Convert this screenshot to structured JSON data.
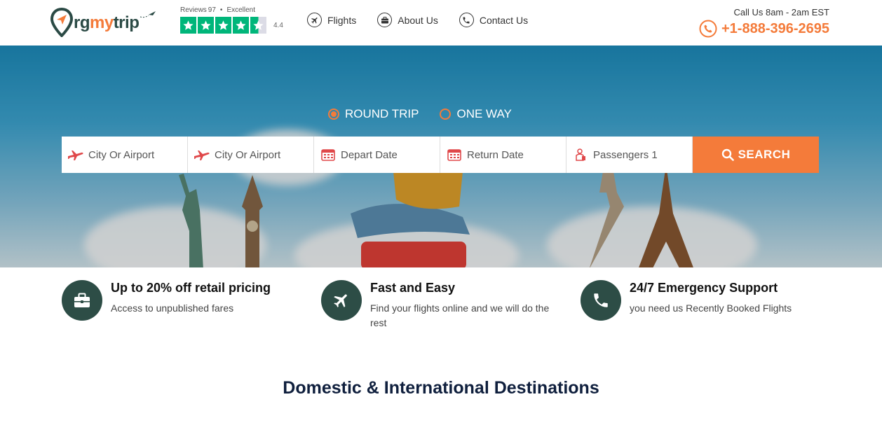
{
  "header": {
    "logo": {
      "part1": "rg",
      "part2": "my",
      "part3": "trip"
    },
    "reviews": {
      "label": "Reviews",
      "count": "97",
      "separator": "•",
      "rating_word": "Excellent",
      "rating": "4.4",
      "stars": 4.5,
      "star_color": "#00b67a"
    },
    "nav": [
      {
        "label": "Flights",
        "icon": "plane-icon"
      },
      {
        "label": "About Us",
        "icon": "briefcase-icon"
      },
      {
        "label": "Contact Us",
        "icon": "phone-icon"
      }
    ],
    "call": {
      "label": "Call Us 8am - 2am EST",
      "phone": "+1-888-396-2695"
    }
  },
  "colors": {
    "accent": "#f47b3a",
    "brand_dark": "#2d4d46",
    "title": "#0f1f3d"
  },
  "search": {
    "trip_types": [
      {
        "label": "ROUND TRIP",
        "selected": true
      },
      {
        "label": "ONE WAY",
        "selected": false
      }
    ],
    "fields": [
      {
        "placeholder": "City Or Airport",
        "icon": "plane-departure-icon"
      },
      {
        "placeholder": "City Or Airport",
        "icon": "plane-arrival-icon"
      },
      {
        "placeholder": "Depart Date",
        "icon": "calendar-icon"
      },
      {
        "placeholder": "Return Date",
        "icon": "calendar-icon"
      },
      {
        "placeholder": "Passengers 1",
        "icon": "passenger-icon"
      }
    ],
    "button": "SEARCH"
  },
  "features": [
    {
      "title": "Up to 20% off retail pricing",
      "desc": "Access to unpublished fares",
      "icon": "briefcase-icon"
    },
    {
      "title": "Fast and Easy",
      "desc": "Find your flights online and we will do the rest",
      "icon": "plane-icon"
    },
    {
      "title": "24/7 Emergency Support",
      "desc": "you need us Recently Booked Flights",
      "icon": "phone-icon"
    }
  ],
  "section_title": "Domestic & International Destinations"
}
